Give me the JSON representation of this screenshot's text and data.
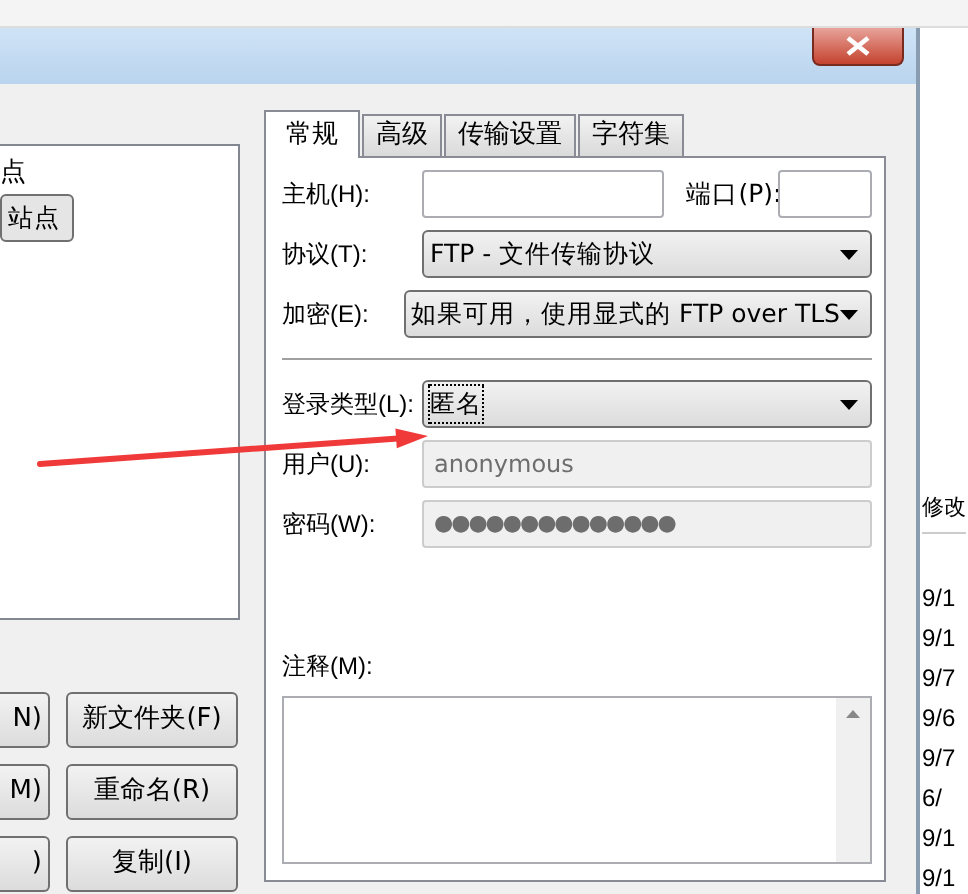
{
  "site_tree": [
    {
      "label": "点",
      "selected": false
    },
    {
      "label": "站点",
      "selected": true
    }
  ],
  "left_buttons": [
    {
      "partial": "N)",
      "label": "新文件夹(F)"
    },
    {
      "partial": "M)",
      "label": "重命名(R)"
    },
    {
      "partial": ")",
      "label": "复制(I)"
    }
  ],
  "tabs": [
    {
      "label": "常规",
      "selected": true
    },
    {
      "label": "高级",
      "selected": false
    },
    {
      "label": "传输设置",
      "selected": false
    },
    {
      "label": "字符集",
      "selected": false
    }
  ],
  "host": {
    "label": "主机(H):"
  },
  "port": {
    "label": "端口(P):"
  },
  "protocol": {
    "label": "协议(T):",
    "value": "FTP - 文件传输协议"
  },
  "encryption": {
    "label": "加密(E):",
    "value": "如果可用，使用显式的 FTP over TLS"
  },
  "logon_type": {
    "label": "登录类型(L):",
    "value": "匿名",
    "focused": true
  },
  "user": {
    "label": "用户(U):",
    "value": "anonymous",
    "disabled": true
  },
  "password": {
    "label": "密码(W):",
    "value": "●●●●●●●●●●●●●●",
    "disabled": true
  },
  "comments": {
    "label": "注释(M):"
  },
  "background_list": {
    "header": "修改",
    "rows": [
      "9/1",
      "9/1",
      "9/7",
      "9/6",
      "9/7",
      "6/",
      "9/1",
      "9/1"
    ]
  }
}
